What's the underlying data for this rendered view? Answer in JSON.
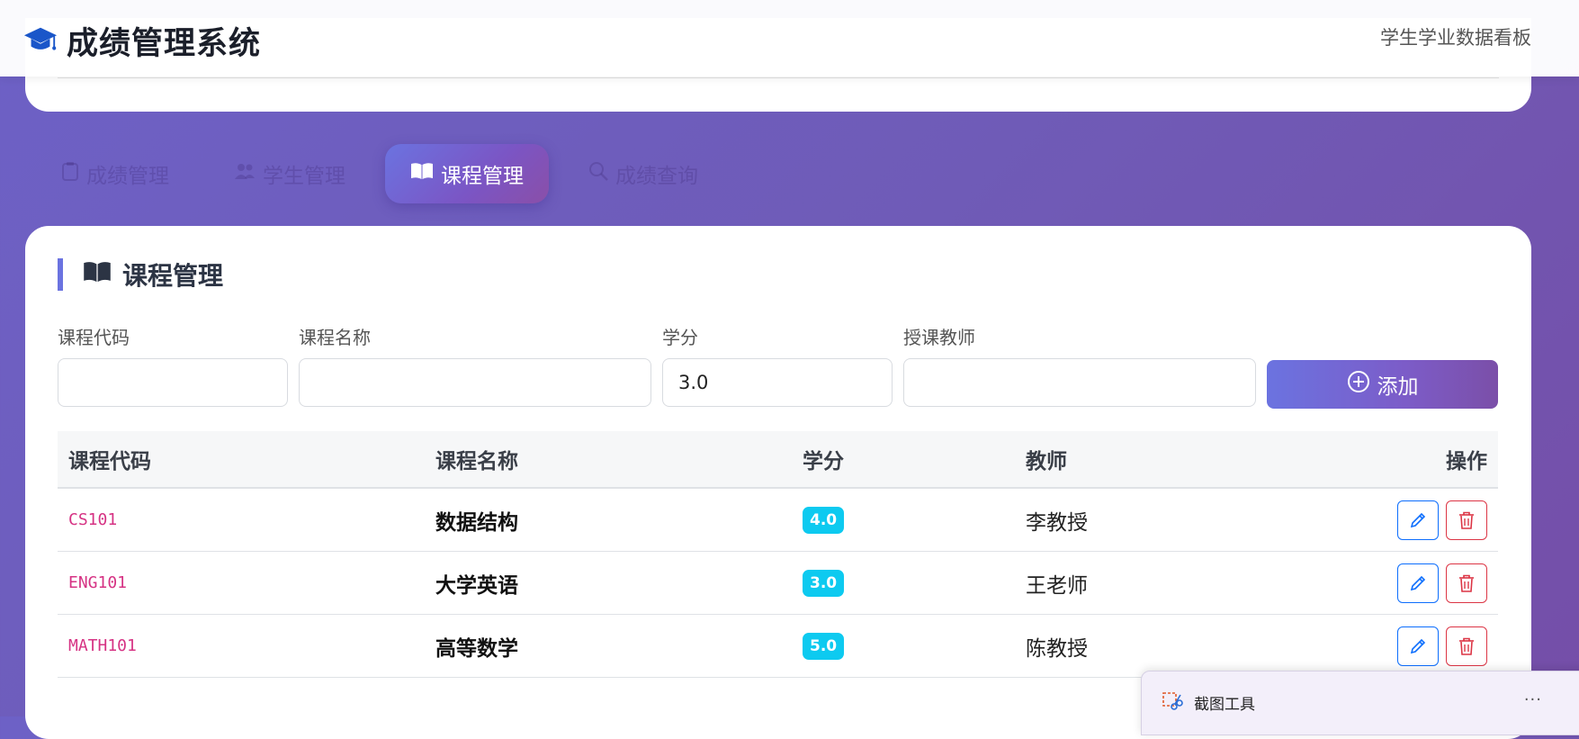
{
  "header": {
    "title": "成绩管理系统",
    "subtitle": "学生学业数据看板"
  },
  "tabs": [
    {
      "label": "成绩管理",
      "active": false
    },
    {
      "label": "学生管理",
      "active": false
    },
    {
      "label": "课程管理",
      "active": true
    },
    {
      "label": "成绩查询",
      "active": false
    }
  ],
  "section": {
    "title": "课程管理"
  },
  "form": {
    "code_label": "课程代码",
    "code_value": "",
    "name_label": "课程名称",
    "name_value": "",
    "credit_label": "学分",
    "credit_value": "3.0",
    "teacher_label": "授课教师",
    "teacher_value": "",
    "add_label": "添加"
  },
  "table": {
    "headers": [
      "课程代码",
      "课程名称",
      "学分",
      "教师",
      "操作"
    ],
    "rows": [
      {
        "code": "CS101",
        "name": "数据结构",
        "credit": "4.0",
        "teacher": "李教授"
      },
      {
        "code": "ENG101",
        "name": "大学英语",
        "credit": "3.0",
        "teacher": "王老师"
      },
      {
        "code": "MATH101",
        "name": "高等数学",
        "credit": "5.0",
        "teacher": "陈教授"
      }
    ]
  },
  "snip_popup": {
    "title": "截图工具",
    "more": "..."
  },
  "colors": {
    "accent": "#6b73e0",
    "code_text": "#d63384",
    "credit_badge": "#0dcaf0",
    "edit_button": "#0d6efd",
    "delete_button": "#dc3545"
  },
  "icons": {
    "brand": "graduation-cap-icon",
    "course": "book-icon",
    "add": "plus-circle-icon",
    "edit": "pencil-icon",
    "delete": "trash-icon"
  }
}
